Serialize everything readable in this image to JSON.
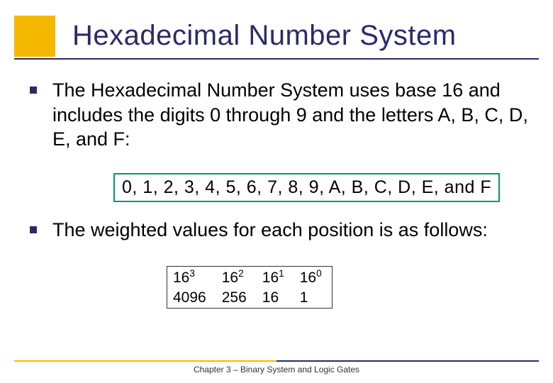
{
  "title": "Hexadecimal Number System",
  "bullets": {
    "intro": "The Hexadecimal Number System uses base 16 and includes the digits 0 through 9 and the letters A, B, C, D, E, and F:",
    "digits_box": "0, 1, 2, 3, 4, 5, 6, 7, 8, 9, A, B, C, D, E,  and F",
    "weighted": "The weighted values for each position is as follows:"
  },
  "table": {
    "powers": [
      "16",
      "16",
      "16",
      "16"
    ],
    "exponents": [
      "3",
      "2",
      "1",
      "0"
    ],
    "values": [
      "4096",
      "256",
      "16",
      "1"
    ]
  },
  "footer": "Chapter 3 – Binary  System and Logic Gates"
}
